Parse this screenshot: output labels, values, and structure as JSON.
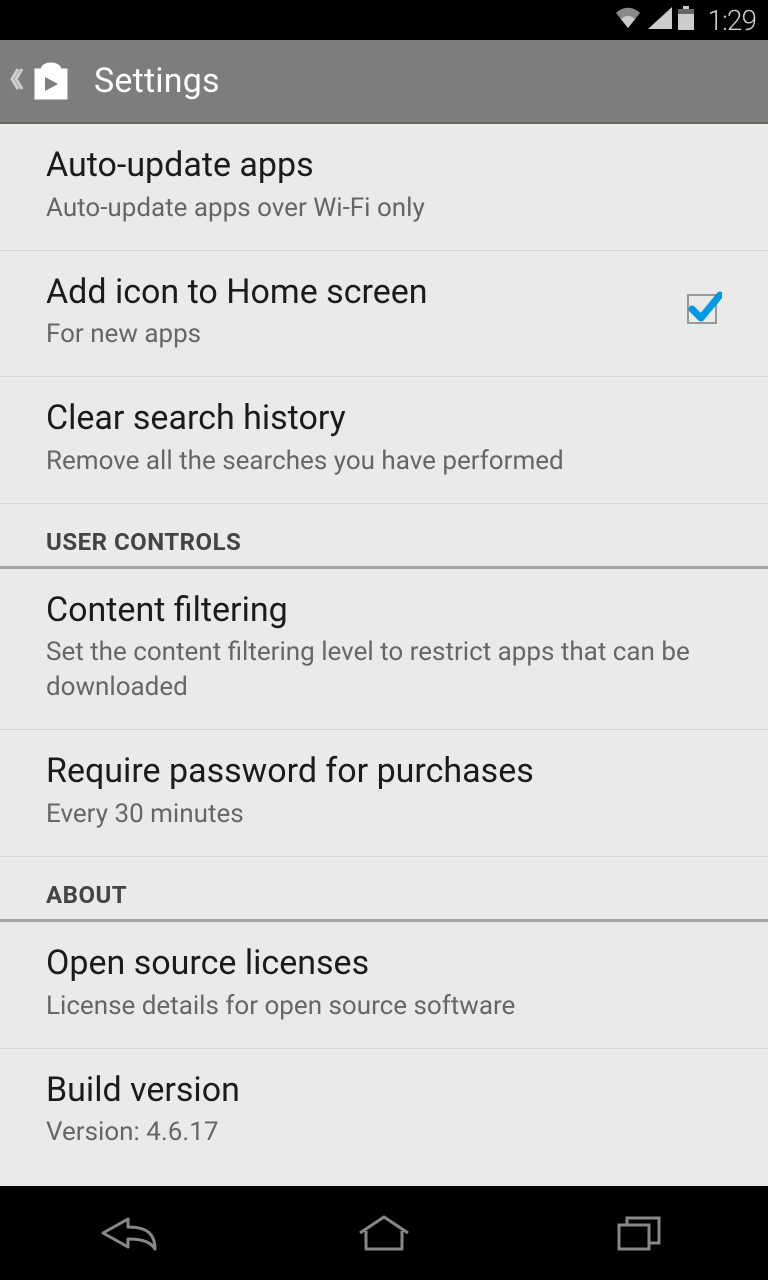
{
  "status": {
    "time": "1:29"
  },
  "header": {
    "title": "Settings"
  },
  "settings": {
    "general": [
      {
        "title": "Auto-update apps",
        "subtitle": "Auto-update apps over Wi-Fi only"
      },
      {
        "title": "Add icon to Home screen",
        "subtitle": "For new apps",
        "checked": true
      },
      {
        "title": "Clear search history",
        "subtitle": "Remove all the searches you have performed"
      }
    ]
  },
  "sections": {
    "user_controls": {
      "header": "USER CONTROLS",
      "items": [
        {
          "title": "Content filtering",
          "subtitle": "Set the content filtering level to restrict apps that can be downloaded"
        },
        {
          "title": "Require password for purchases",
          "subtitle": "Every 30 minutes"
        }
      ]
    },
    "about": {
      "header": "ABOUT",
      "items": [
        {
          "title": "Open source licenses",
          "subtitle": "License details for open source software"
        },
        {
          "title": "Build version",
          "subtitle": "Version: 4.6.17"
        }
      ]
    }
  }
}
